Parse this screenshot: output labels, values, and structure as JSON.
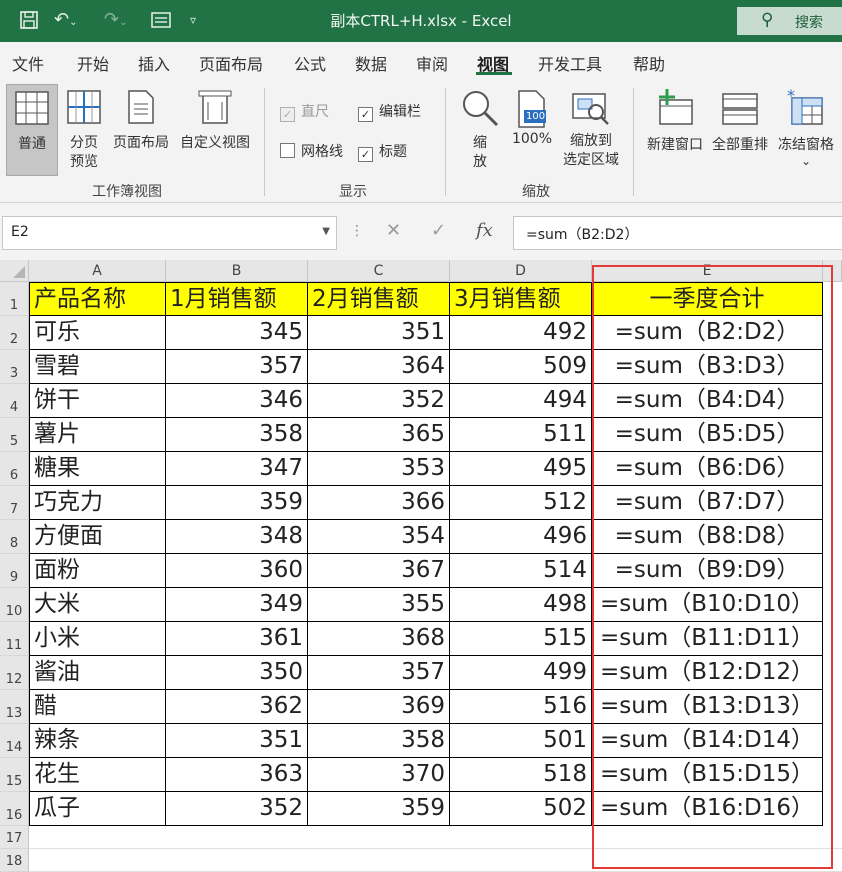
{
  "window": {
    "title": "副本CTRL+H.xlsx  -  Excel",
    "search_label": "搜索"
  },
  "menu": [
    "文件",
    "开始",
    "插入",
    "页面布局",
    "公式",
    "数据",
    "审阅",
    "视图",
    "开发工具",
    "帮助"
  ],
  "ribbon": {
    "workbook_views": {
      "label": "工作簿视图",
      "normal": "普通",
      "page_break_1": "分页",
      "page_break_2": "预览",
      "page_layout": "页面布局",
      "custom": "自定义视图"
    },
    "show": {
      "label": "显示",
      "ruler": "直尺",
      "formula_bar": "编辑栏",
      "gridlines": "网格线",
      "headings": "标题"
    },
    "zoom": {
      "label": "缩放",
      "zoom_1": "缩",
      "zoom_2": "放",
      "hundred": "100%",
      "to_sel_1": "缩放到",
      "to_sel_2": "选定区域",
      "hundred_icon": "100"
    },
    "window": {
      "new_window": "新建窗口",
      "arrange_all": "全部重排",
      "freeze": "冻结窗格",
      "freeze_caret": "⌄"
    }
  },
  "formula_bar": {
    "name_box": "E2",
    "formula": "=sum（B2:D2）"
  },
  "columns": [
    "A",
    "B",
    "C",
    "D",
    "E"
  ],
  "header_row": [
    "产品名称",
    "1月销售额",
    "2月销售额",
    "3月销售额",
    "一季度合计"
  ],
  "rows": [
    [
      "2",
      "可乐",
      "345",
      "351",
      "492",
      "=sum（B2:D2）"
    ],
    [
      "3",
      "雪碧",
      "357",
      "364",
      "509",
      "=sum（B3:D3）"
    ],
    [
      "4",
      "饼干",
      "346",
      "352",
      "494",
      "=sum（B4:D4）"
    ],
    [
      "5",
      "薯片",
      "358",
      "365",
      "511",
      "=sum（B5:D5）"
    ],
    [
      "6",
      "糖果",
      "347",
      "353",
      "495",
      "=sum（B6:D6）"
    ],
    [
      "7",
      "巧克力",
      "359",
      "366",
      "512",
      "=sum（B7:D7）"
    ],
    [
      "8",
      "方便面",
      "348",
      "354",
      "496",
      "=sum（B8:D8）"
    ],
    [
      "9",
      "面粉",
      "360",
      "367",
      "514",
      "=sum（B9:D9）"
    ],
    [
      "10",
      "大米",
      "349",
      "355",
      "498",
      "=sum（B10:D10）"
    ],
    [
      "11",
      "小米",
      "361",
      "368",
      "515",
      "=sum（B11:D11）"
    ],
    [
      "12",
      "酱油",
      "350",
      "357",
      "499",
      "=sum（B12:D12）"
    ],
    [
      "13",
      "醋",
      "362",
      "369",
      "516",
      "=sum（B13:D13）"
    ],
    [
      "14",
      "辣条",
      "351",
      "358",
      "501",
      "=sum（B14:D14）"
    ],
    [
      "15",
      "花生",
      "363",
      "370",
      "518",
      "=sum（B15:D15）"
    ],
    [
      "16",
      "瓜子",
      "352",
      "359",
      "502",
      "=sum（B16:D16）"
    ]
  ],
  "row_numbers": [
    "1",
    "17",
    "18"
  ],
  "colors": {
    "excel_green": "#217346",
    "header_fill": "#ffff00",
    "highlight_red": "#e53935"
  }
}
